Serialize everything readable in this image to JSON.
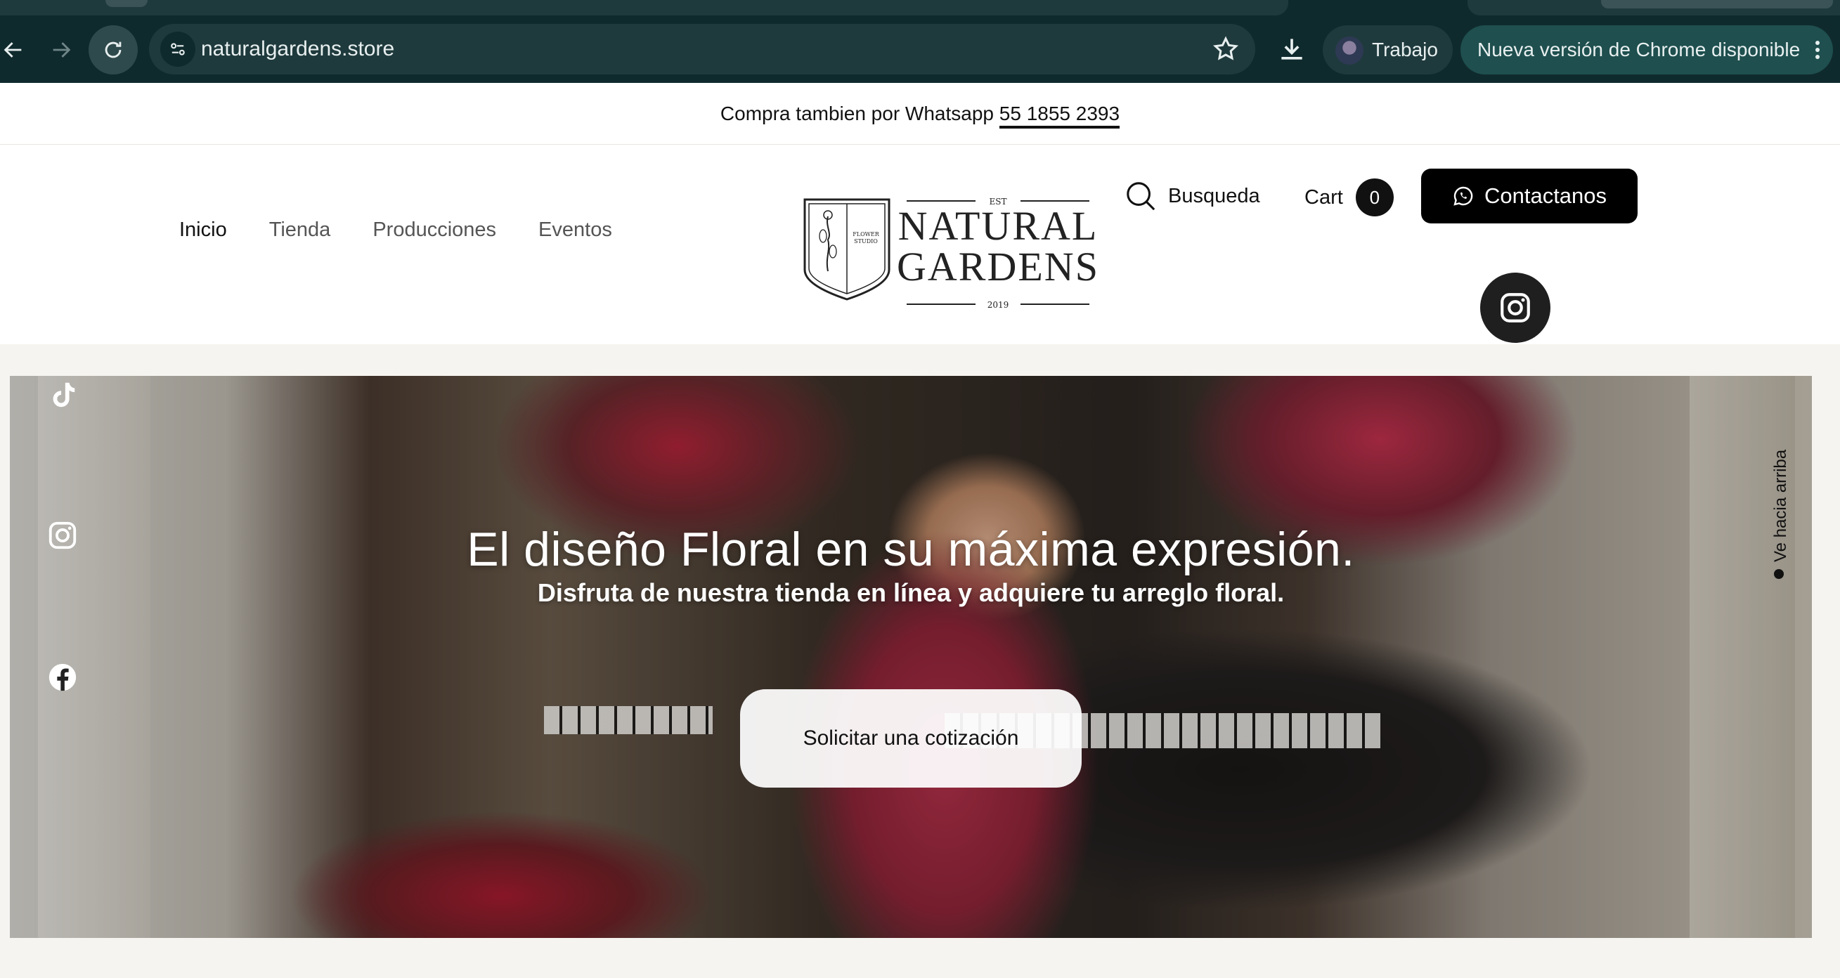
{
  "browser": {
    "url": "naturalgardens.store",
    "profile_label": "Trabajo",
    "update_label": "Nueva versión de Chrome disponible"
  },
  "announcement": {
    "text": "Compra tambien por Whatsapp",
    "phone": "55 1855 2393"
  },
  "nav": {
    "items": [
      "Inicio",
      "Tienda",
      "Producciones",
      "Eventos"
    ]
  },
  "logo": {
    "est": "EST",
    "line1": "NATURAL",
    "line2": "GARDENS",
    "year": "2019",
    "shield_text_1": "FLOWER",
    "shield_text_2": "STUDIO"
  },
  "header_actions": {
    "search_label": "Busqueda",
    "cart_label": "Cart",
    "cart_count": "0",
    "contact_label": "Contactanos"
  },
  "hero": {
    "title": "El diseño Floral en su máxima expresión.",
    "subtitle": "Disfruta de nuestra tienda en línea y adquiere tu arreglo floral.",
    "cta_label": "Solicitar una cotización",
    "back_to_top": "Ve hacia arriba"
  }
}
